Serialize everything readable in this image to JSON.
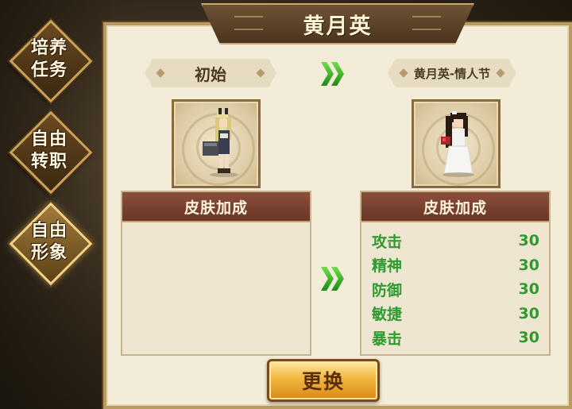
{
  "title": "黄月英",
  "side_menu": [
    {
      "label": "培养\n任务",
      "active": false
    },
    {
      "label": "自由\n转职",
      "active": false
    },
    {
      "label": "自由\n形象",
      "active": true
    }
  ],
  "left": {
    "name": "初始",
    "bonus_header": "皮肤加成",
    "stats": []
  },
  "right": {
    "name": "黄月英-情人节",
    "bonus_header": "皮肤加成",
    "stats": [
      {
        "label": "攻击",
        "value": "30"
      },
      {
        "label": "精神",
        "value": "30"
      },
      {
        "label": "防御",
        "value": "30"
      },
      {
        "label": "敏捷",
        "value": "30"
      },
      {
        "label": "暴击",
        "value": "30"
      }
    ]
  },
  "change_button": "更换",
  "icons": [
    "double-chevron-right-icon"
  ],
  "colors": {
    "stat_text": "#2f9a2f",
    "header_bg": "#7a4230",
    "arrow": "#3fb52c"
  }
}
